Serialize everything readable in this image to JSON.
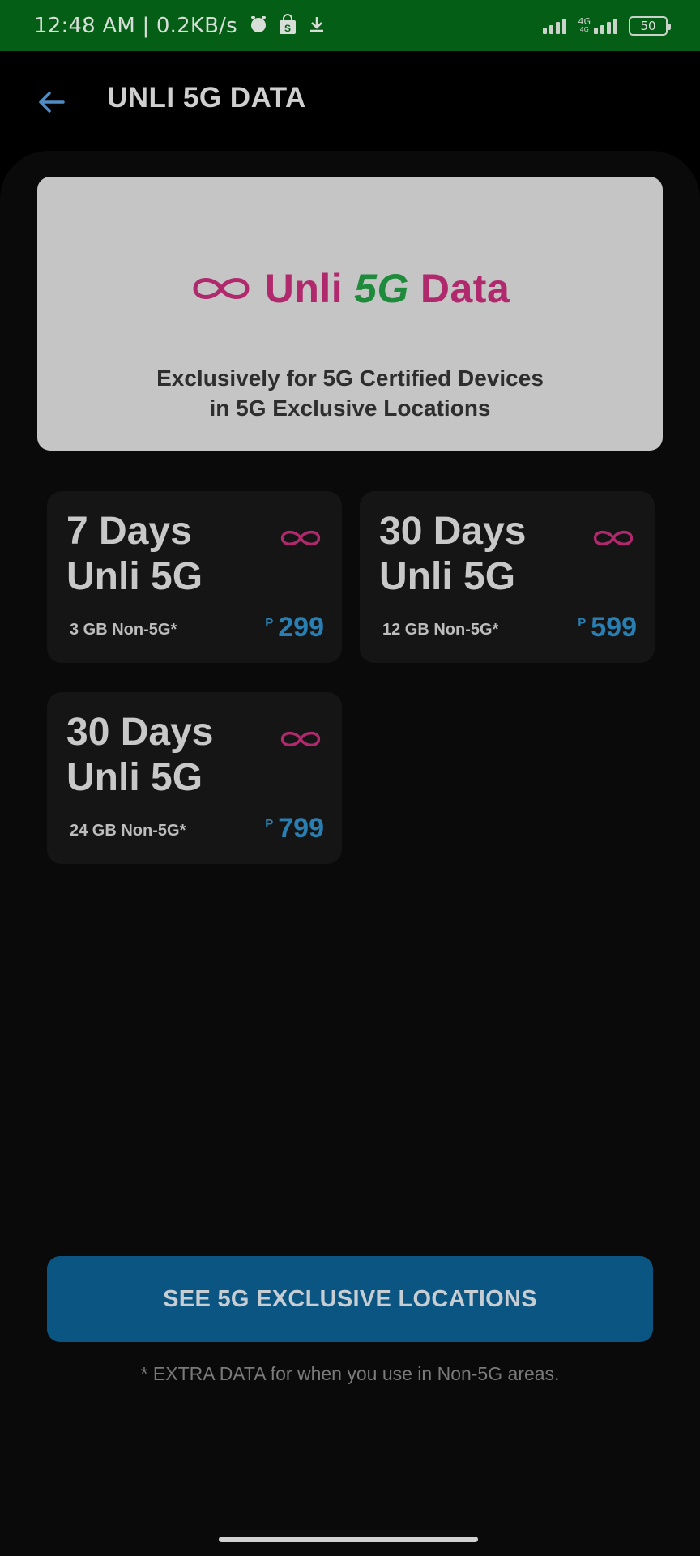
{
  "status_bar": {
    "time": "12:48 AM | 0.2KB/s",
    "network_label_top": "4G",
    "network_label_bottom": "4G",
    "battery": "50",
    "icons": [
      "alarm-icon",
      "shopping-bag-icon",
      "download-icon",
      "signal-icon",
      "signal-icon",
      "battery-icon"
    ]
  },
  "header": {
    "title": "UNLI 5G DATA",
    "back_icon": "arrow-left-icon"
  },
  "banner": {
    "logo_word_1": "Unli",
    "logo_word_2": "5G",
    "logo_word_3": "Data",
    "subtitle": "Exclusively for 5G Certified Devices\nin 5G Exclusive Locations",
    "logo_colors": {
      "brand": "#b0296d",
      "fiveg": "#1e8a3c"
    }
  },
  "plans": [
    {
      "title": "7 Days\nUnli 5G",
      "data": "3 GB Non-5G*",
      "currency": "P",
      "price": "299"
    },
    {
      "title": "30 Days\nUnli 5G",
      "data": "12 GB Non-5G*",
      "currency": "P",
      "price": "599"
    },
    {
      "title": "30 Days\nUnli 5G",
      "data": "24 GB Non-5G*",
      "currency": "P",
      "price": "799"
    }
  ],
  "cta": {
    "label": "SEE 5G EXCLUSIVE LOCATIONS"
  },
  "footnote": "* EXTRA DATA for when you use in Non-5G areas.",
  "colors": {
    "status_bar": "#055e15",
    "accent_blue": "#2a7fb2",
    "infinity_pink": "#b0296d",
    "button_blue": "#0b5583"
  }
}
